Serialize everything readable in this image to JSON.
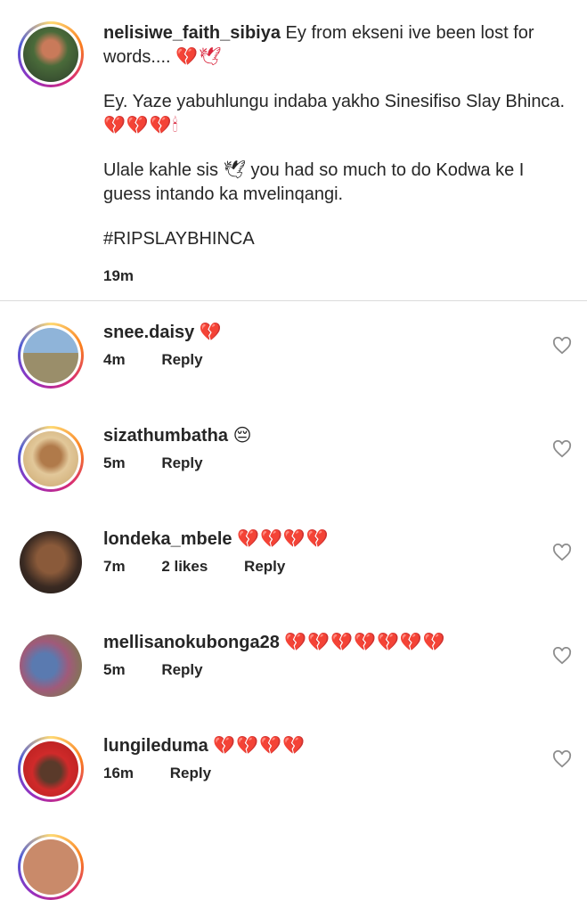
{
  "caption": {
    "username": "nelisiwe_faith_sibiya",
    "line1": " Ey from ekseni ive been lost for words.... ",
    "line1_emoji": "💔🕊",
    "para2": "Ey. Yaze yabuhlungu indaba yakho Sinesifiso Slay Bhinca. ",
    "para2_emoji": "💔💔💔🕯",
    "para3_a": "Ulale kahle sis ",
    "para3_emoji": "🕊",
    "para3_b": " you had so much to do Kodwa ke I guess intando ka mvelinqangi.",
    "hashtag": "#RIPSLAYBHINCA",
    "time": "19m"
  },
  "comments": [
    {
      "username": "snee.daisy",
      "emoji": "💔",
      "time": "4m",
      "likes": "",
      "reply": "Reply"
    },
    {
      "username": "sizathumbatha",
      "emoji": "😔",
      "time": "5m",
      "likes": "",
      "reply": "Reply"
    },
    {
      "username": "londeka_mbele",
      "emoji": "💔💔💔💔",
      "time": "7m",
      "likes": "2 likes",
      "reply": "Reply"
    },
    {
      "username": "mellisanokubonga28",
      "emoji": "💔💔💔💔💔💔💔",
      "time": "5m",
      "likes": "",
      "reply": "Reply"
    },
    {
      "username": "lungileduma",
      "emoji": "💔💔💔💔",
      "time": "16m",
      "likes": "",
      "reply": "Reply"
    }
  ],
  "colors": {
    "heart": "#d9263d",
    "divider": "#dbdbdb",
    "text": "#262626"
  }
}
